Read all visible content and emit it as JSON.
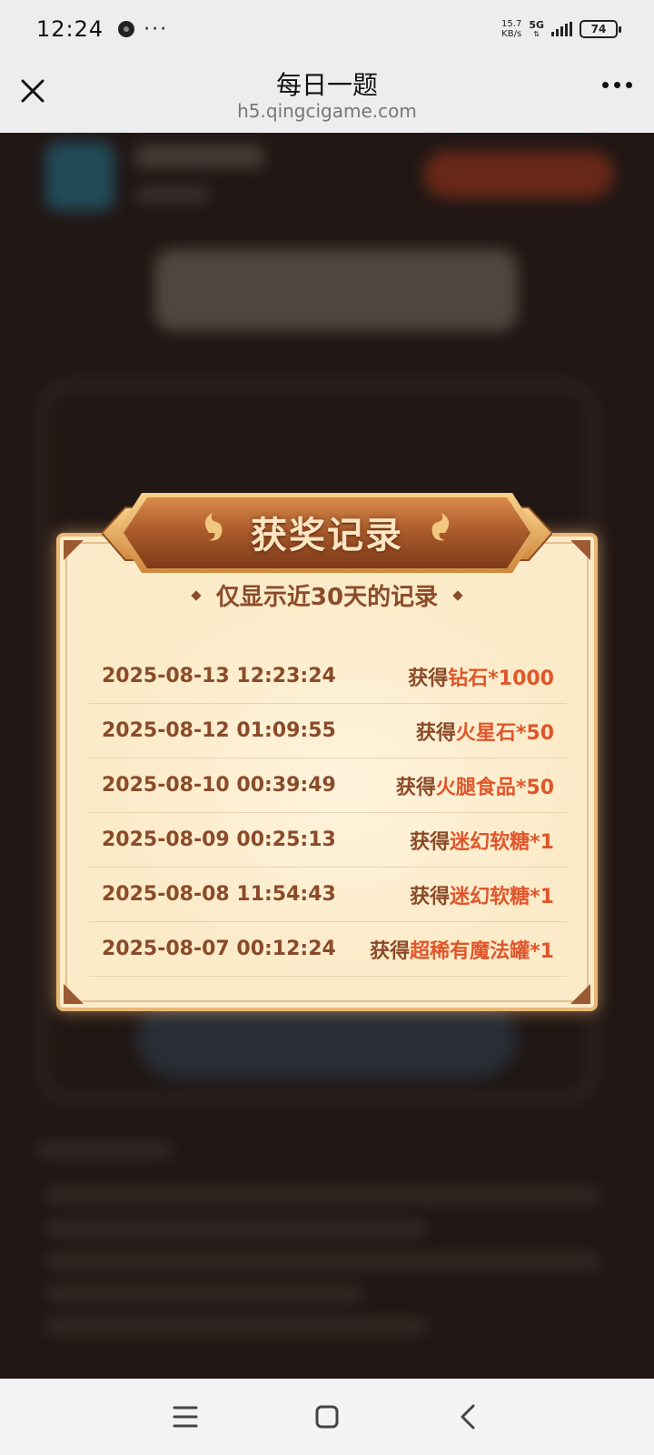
{
  "status_bar": {
    "time": "12:24",
    "more": "···",
    "net_speed_value": "15.7",
    "net_speed_unit": "KB/s",
    "network": "5G",
    "battery": "74"
  },
  "nav": {
    "title": "每日一题",
    "url": "h5.qingcigame.com"
  },
  "modal": {
    "title": "获奖记录",
    "subtitle": "仅显示近30天的记录",
    "records": [
      {
        "time": "2025-08-13 12:23:24",
        "prefix": "获得",
        "item": "钻石*1000"
      },
      {
        "time": "2025-08-12 01:09:55",
        "prefix": "获得",
        "item": "火星石*50"
      },
      {
        "time": "2025-08-10 00:39:49",
        "prefix": "获得",
        "item": "火腿食品*50"
      },
      {
        "time": "2025-08-09 00:25:13",
        "prefix": "获得",
        "item": "迷幻软糖*1"
      },
      {
        "time": "2025-08-08 11:54:43",
        "prefix": "获得",
        "item": "迷幻软糖*1"
      },
      {
        "time": "2025-08-07 00:12:24",
        "prefix": "获得",
        "item": "超稀有魔法罐*1"
      }
    ]
  },
  "colors": {
    "accent": "#e0562b",
    "text_brown": "#8a4b2a",
    "modal_bg": "#fcebc9",
    "banner": "#a8592a"
  },
  "icons": {
    "close": "close-icon",
    "menu": "more-dots-icon",
    "home": "home-square-icon",
    "back": "back-chevron-icon",
    "recents": "menu-lines-icon"
  }
}
